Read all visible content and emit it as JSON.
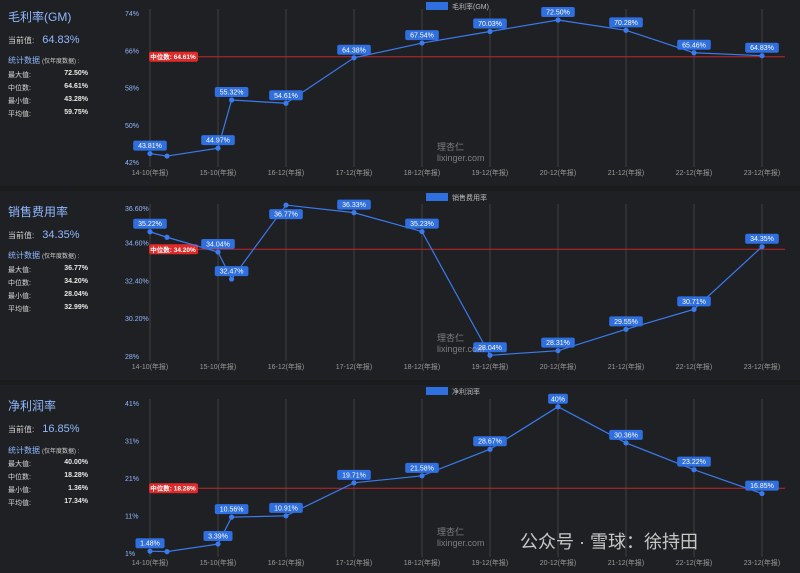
{
  "x_categories": [
    "14-10(年报)",
    "15-10(年报)",
    "16-12(年报)",
    "17-12(年报)",
    "18-12(年报)",
    "19-12(年报)",
    "20-12(年报)",
    "21-12(年报)",
    "22-12(年报)",
    "23-12(年报)"
  ],
  "stats_title": "统计数据",
  "stats_note": "(仅年度数据) :",
  "labels": {
    "current": "当前值:",
    "max": "最大值:",
    "median": "中位数:",
    "min": "最小值:",
    "mean": "平均值:"
  },
  "median_prefix": "中位数:",
  "logo_text": "理杏仁",
  "logo_domain": "lixinger.com",
  "watermark": "公众号 · 雪球：徐持田",
  "colors": {
    "line": "#3a7bf0",
    "label_bg": "#2f6fe0",
    "median_line": "#c0282a",
    "median_label_bg": "#e02a2a",
    "grid": "#4a4a4a"
  },
  "panels": [
    {
      "key": "gm",
      "title": "毛利率(GM)",
      "current": "64.83%",
      "stats": {
        "max": "72.50%",
        "median": "64.61%",
        "min": "43.28%",
        "mean": "59.75%"
      },
      "median_label": "64.61%",
      "chart_data": {
        "type": "line",
        "legend": "毛利率(GM)",
        "ylim": [
          42,
          74
        ],
        "yticks": [
          "74%",
          "66%",
          "58%",
          "50%",
          "42%"
        ],
        "ytick_values": [
          74,
          66,
          58,
          50,
          42
        ],
        "median": 64.61,
        "points": [
          {
            "x": 0.0,
            "y": 43.81,
            "label": "43.81%"
          },
          {
            "x": 0.25,
            "y": 43.28,
            "label": ""
          },
          {
            "x": 1.0,
            "y": 44.97,
            "label": "44.97%"
          },
          {
            "x": 1.2,
            "y": 55.32,
            "label": "55.32%"
          },
          {
            "x": 2.0,
            "y": 54.61,
            "label": "54.61%"
          },
          {
            "x": 3.0,
            "y": 64.38,
            "label": "64.38%"
          },
          {
            "x": 4.0,
            "y": 67.54,
            "label": "67.54%"
          },
          {
            "x": 5.0,
            "y": 70.03,
            "label": "70.03%"
          },
          {
            "x": 6.0,
            "y": 72.5,
            "label": "72.50%"
          },
          {
            "x": 7.0,
            "y": 70.28,
            "label": "70.28%"
          },
          {
            "x": 8.0,
            "y": 65.46,
            "label": "65.46%"
          },
          {
            "x": 9.0,
            "y": 64.83,
            "label": "64.83%"
          }
        ]
      }
    },
    {
      "key": "sales",
      "title": "销售费用率",
      "current": "34.35%",
      "stats": {
        "max": "36.77%",
        "median": "34.20%",
        "min": "28.04%",
        "mean": "32.99%"
      },
      "median_label": "34.20%",
      "chart_data": {
        "type": "line",
        "legend": "销售费用率",
        "ylim": [
          28,
          36.6
        ],
        "yticks": [
          "36.60%",
          "34.60%",
          "32.40%",
          "30.20%",
          "28%"
        ],
        "ytick_values": [
          36.6,
          34.6,
          32.4,
          30.2,
          28
        ],
        "median": 34.2,
        "points": [
          {
            "x": 0.0,
            "y": 35.22,
            "label": "35.22%"
          },
          {
            "x": 0.25,
            "y": 34.9,
            "label": ""
          },
          {
            "x": 1.0,
            "y": 34.04,
            "label": "34.04%"
          },
          {
            "x": 1.2,
            "y": 32.47,
            "label": "32.47%"
          },
          {
            "x": 2.0,
            "y": 36.77,
            "label": "36.77%"
          },
          {
            "x": 3.0,
            "y": 36.33,
            "label": "36.33%"
          },
          {
            "x": 4.0,
            "y": 35.23,
            "label": "35.23%"
          },
          {
            "x": 5.0,
            "y": 28.04,
            "label": "28.04%"
          },
          {
            "x": 6.0,
            "y": 28.31,
            "label": "28.31%"
          },
          {
            "x": 7.0,
            "y": 29.55,
            "label": "29.55%"
          },
          {
            "x": 8.0,
            "y": 30.71,
            "label": "30.71%"
          },
          {
            "x": 9.0,
            "y": 34.35,
            "label": "34.35%"
          }
        ]
      }
    },
    {
      "key": "net",
      "title": "净利润率",
      "current": "16.85%",
      "stats": {
        "max": "40.00%",
        "median": "18.28%",
        "min": "1.36%",
        "mean": "17.34%"
      },
      "median_label": "18.28%",
      "chart_data": {
        "type": "line",
        "legend": "净利润率",
        "ylim": [
          1,
          41
        ],
        "yticks": [
          "41%",
          "31%",
          "21%",
          "11%",
          "1%"
        ],
        "ytick_values": [
          41,
          31,
          21,
          11,
          1
        ],
        "median": 18.28,
        "points": [
          {
            "x": 0.0,
            "y": 1.48,
            "label": "1.48%"
          },
          {
            "x": 0.25,
            "y": 1.36,
            "label": ""
          },
          {
            "x": 1.0,
            "y": 3.39,
            "label": "3.39%"
          },
          {
            "x": 1.2,
            "y": 10.56,
            "label": "10.56%"
          },
          {
            "x": 2.0,
            "y": 10.91,
            "label": "10.91%"
          },
          {
            "x": 3.0,
            "y": 19.71,
            "label": "19.71%"
          },
          {
            "x": 4.0,
            "y": 21.58,
            "label": "21.58%"
          },
          {
            "x": 5.0,
            "y": 28.67,
            "label": "28.67%"
          },
          {
            "x": 6.0,
            "y": 40.0,
            "label": "40%"
          },
          {
            "x": 7.0,
            "y": 30.36,
            "label": "30.36%"
          },
          {
            "x": 8.0,
            "y": 23.22,
            "label": "23.22%"
          },
          {
            "x": 9.0,
            "y": 16.85,
            "label": "16.85%"
          }
        ]
      }
    }
  ]
}
